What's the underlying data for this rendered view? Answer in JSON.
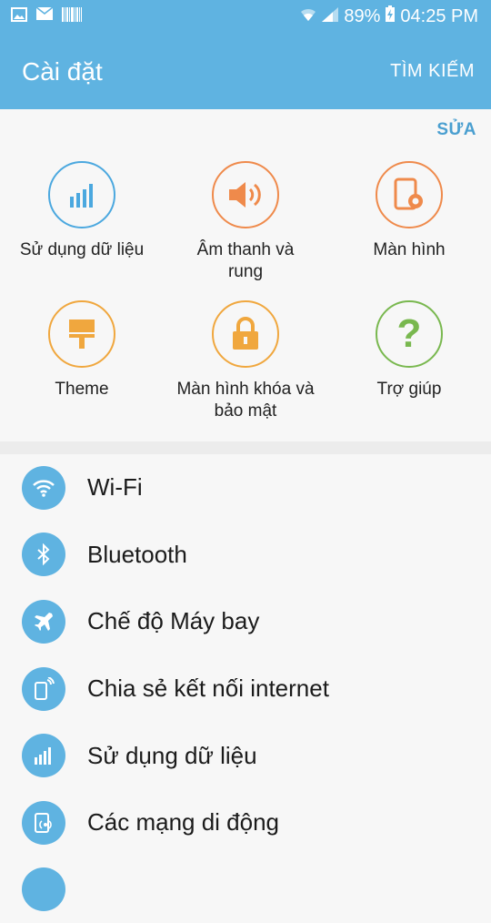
{
  "status_bar": {
    "battery": "89%",
    "time": "04:25 PM"
  },
  "app_bar": {
    "title": "Cài đặt",
    "search_label": "TÌM KIẾM"
  },
  "quick_settings": {
    "edit_label": "SỬA",
    "items": [
      {
        "label": "Sử dụng dữ liệu",
        "icon": "data-usage-icon",
        "color": "#4ba8df"
      },
      {
        "label": "Âm thanh và rung",
        "icon": "speaker-icon",
        "color": "#ef8a4b"
      },
      {
        "label": "Màn hình",
        "icon": "display-icon",
        "color": "#ef8a4b"
      },
      {
        "label": "Theme",
        "icon": "theme-brush-icon",
        "color": "#f0a73e"
      },
      {
        "label": "Màn hình khóa và bảo mật",
        "icon": "lock-icon",
        "color": "#f0a73e"
      },
      {
        "label": "Trợ giúp",
        "icon": "help-icon",
        "color": "#79b84f"
      }
    ]
  },
  "settings_list": [
    {
      "label": "Wi-Fi",
      "icon": "wifi-icon"
    },
    {
      "label": "Bluetooth",
      "icon": "bluetooth-icon"
    },
    {
      "label": "Chế độ Máy bay",
      "icon": "airplane-icon"
    },
    {
      "label": "Chia sẻ kết nối internet",
      "icon": "tethering-icon"
    },
    {
      "label": "Sử dụng dữ liệu",
      "icon": "data-usage-icon"
    },
    {
      "label": "Các mạng di động",
      "icon": "mobile-network-icon"
    }
  ],
  "colors": {
    "accent": "#5fb3e1",
    "edit": "#4a9fd0"
  }
}
